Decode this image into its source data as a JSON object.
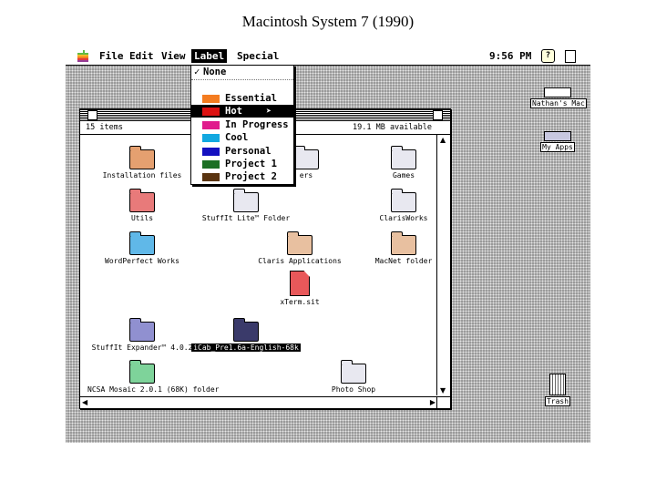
{
  "caption": "Macintosh System 7 (1990)",
  "menubar": {
    "items": [
      "File",
      "Edit",
      "View",
      "Label",
      "Special"
    ],
    "clock": "9:56 PM",
    "apple_icon": "apple-icon",
    "help_icon": "help-icon",
    "app_icon": "finder-app-icon"
  },
  "label_menu": {
    "items": [
      {
        "label": "None",
        "checked": true,
        "color": ""
      },
      {
        "label": "Essential",
        "color": "#f47c20"
      },
      {
        "label": "Hot",
        "color": "#dd1111",
        "selected": true
      },
      {
        "label": "In Progress",
        "color": "#e01c8c"
      },
      {
        "label": "Cool",
        "color": "#12a8e0"
      },
      {
        "label": "Personal",
        "color": "#1410c0"
      },
      {
        "label": "Project 1",
        "color": "#1c6f24"
      },
      {
        "label": "Project 2",
        "color": "#5a3410"
      }
    ]
  },
  "window": {
    "items_count": "15 items",
    "available": "19.1 MB available",
    "icons": [
      {
        "label": "Installation files",
        "color": "#e5a070",
        "kind": "folder"
      },
      {
        "label": "ers",
        "color": "#e8e8f0",
        "kind": "folder"
      },
      {
        "label": "Games",
        "color": "#e8e8f0",
        "kind": "folder"
      },
      {
        "label": "Utils",
        "color": "#e87a7a",
        "kind": "folder"
      },
      {
        "label": "StuffIt Lite™ Folder",
        "color": "#e8e8f0",
        "kind": "folder"
      },
      {
        "label": "ClarisWorks",
        "color": "#e8e8f0",
        "kind": "folder"
      },
      {
        "label": "WordPerfect Works",
        "color": "#60b8e8",
        "kind": "folder"
      },
      {
        "label": "Claris Applications",
        "color": "#e8c0a0",
        "kind": "folder"
      },
      {
        "label": "MacNet folder",
        "color": "#e8c0a0",
        "kind": "folder"
      },
      {
        "label": "xTerm.sit",
        "color": "#e8585a",
        "kind": "document"
      },
      {
        "label": "StuffIt Expander™ 4.0.2",
        "color": "#9090d0",
        "kind": "folder"
      },
      {
        "label": "iCab_Pre1.6a-English-68k",
        "color": "#3a3a6a",
        "kind": "folder",
        "selected": true
      },
      {
        "label": "NCSA Mosaic 2.0.1 (68K) folder",
        "color": "#7ed39a",
        "kind": "folder"
      },
      {
        "label": "Photo Shop",
        "color": "#e8e8f0",
        "kind": "folder"
      }
    ]
  },
  "desktop": {
    "disk1_label": "Nathan's Mac",
    "disk2_label": "My Apps",
    "trash_label": "Trash"
  }
}
